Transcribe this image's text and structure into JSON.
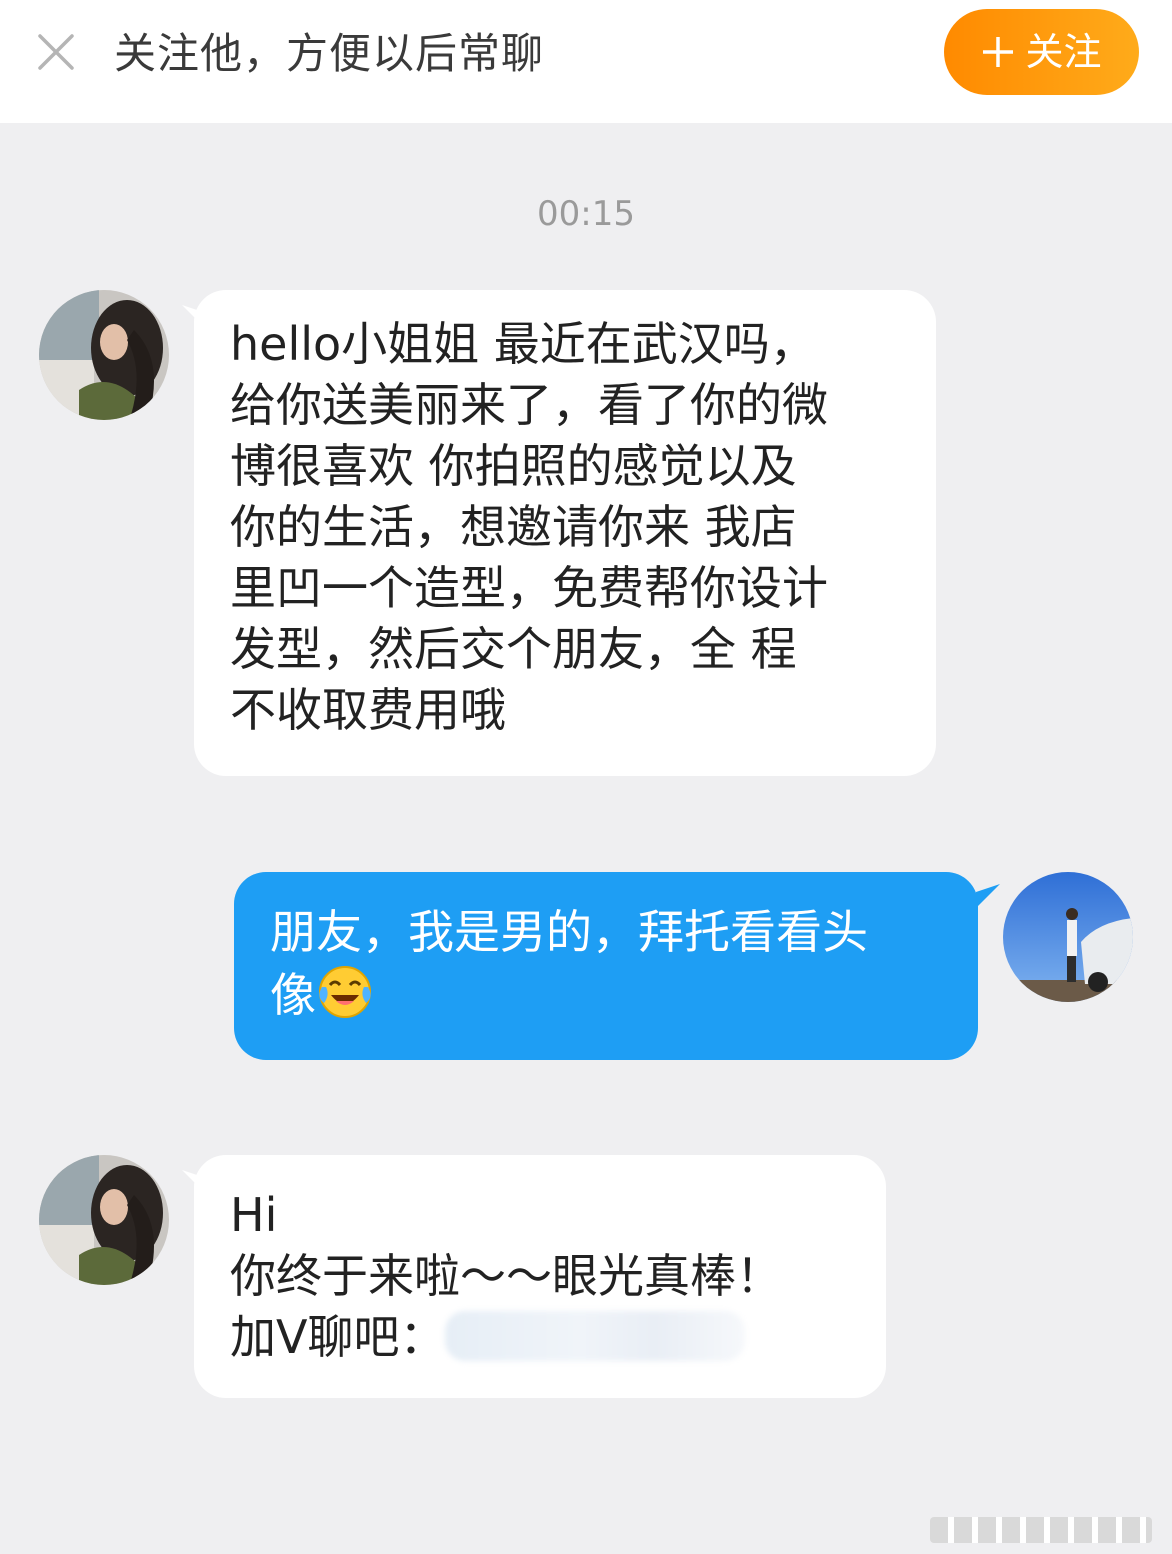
{
  "header": {
    "banner_text": "关注他，方便以后常聊",
    "follow_label": "关注",
    "follow_color": "#ff9500"
  },
  "chat": {
    "timestamp": "00:15",
    "messages": [
      {
        "sender": "other",
        "text": "hello小姐姐 最近在武汉吗，\n给你送美丽来了，看了你的微\n博很喜欢 你拍照的感觉以及\n你的生活，想邀请你来 我店\n里凹一个造型，免费帮你设计\n发型，然后交个朋友，全 程\n不收取费用哦"
      },
      {
        "sender": "self",
        "text": "朋友，我是男的，拜托看看头\n像",
        "emoji": "laughing-crying-emoji"
      },
      {
        "sender": "other",
        "line1": "Hi",
        "line2": "你终于来啦～～眼光真棒！",
        "line3": "加V聊吧："
      }
    ]
  },
  "colors": {
    "background": "#efeff1",
    "incoming_bubble": "#ffffff",
    "outgoing_bubble": "#1e9ef4"
  }
}
